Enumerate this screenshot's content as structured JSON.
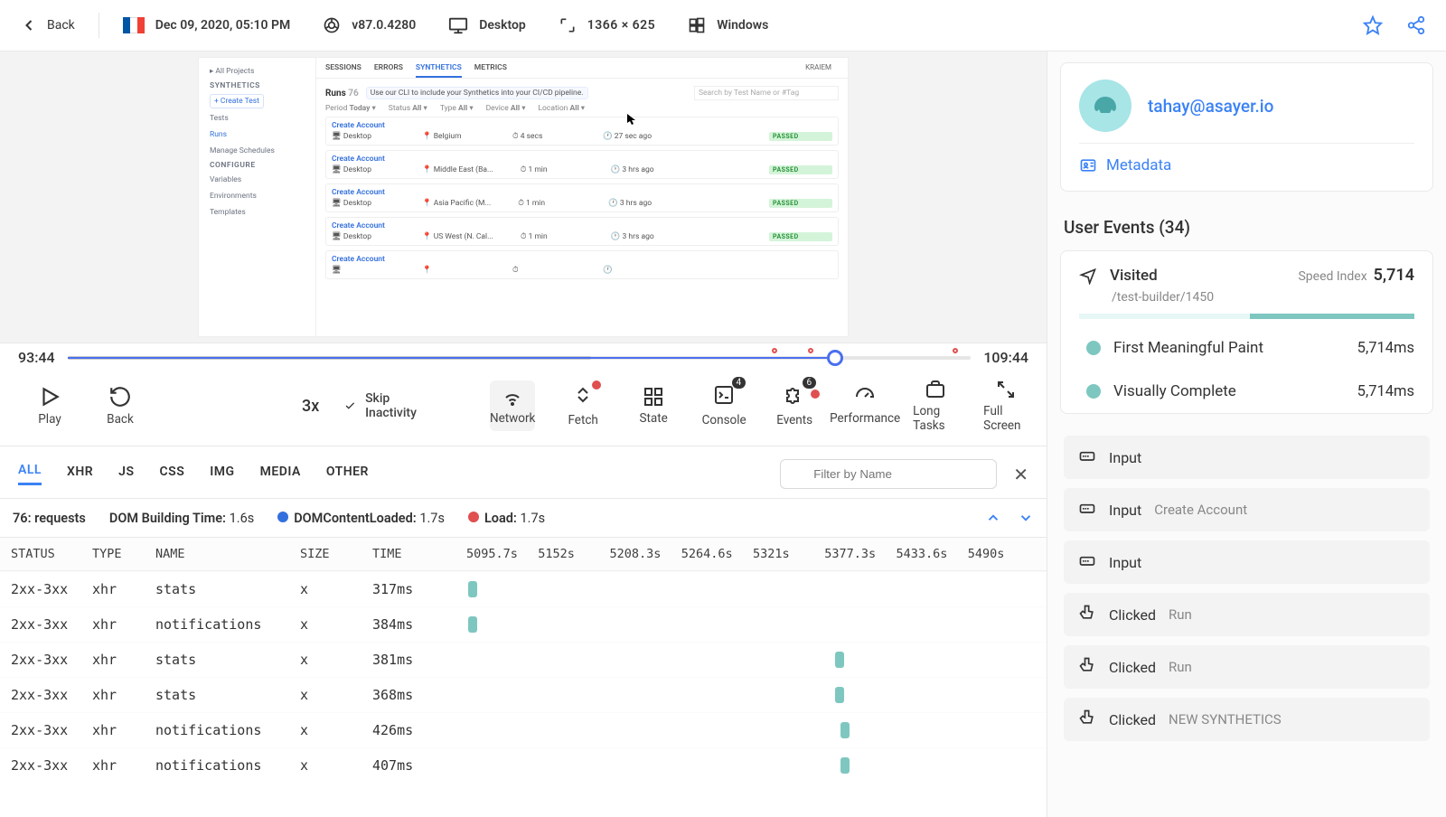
{
  "topbar": {
    "back_label": "Back",
    "date": "Dec 09, 2020, 05:10 PM",
    "browser_version": "v87.0.4280",
    "device": "Desktop",
    "dimensions": "1366 × 625",
    "os": "Windows"
  },
  "preview": {
    "side_header": "SYNTHETICS",
    "create_btn": "+ Create Test",
    "nav_tests": "Tests",
    "nav_runs": "Runs",
    "nav_schedules": "Manage Schedules",
    "config_header": "CONFIGURE",
    "nav_variables": "Variables",
    "nav_env": "Environments",
    "nav_templates": "Templates",
    "all_projects": "All Projects",
    "tabs_sessions": "SESSIONS",
    "tabs_errors": "ERRORS",
    "tabs_synthetics": "SYNTHETICS",
    "tabs_metrics": "METRICS",
    "user": "KRAIEM",
    "runs_label": "Runs",
    "runs_count": "76",
    "hint": "Use our CLI to include your Synthetics into your CI/CD pipeline.",
    "search_placeholder": "Search by Test Name or #Tag",
    "filters": {
      "period": "Period",
      "period_v": "Today",
      "status": "Status",
      "status_v": "All",
      "type": "Type",
      "type_v": "All",
      "device": "Device",
      "device_v": "All",
      "location": "Location",
      "location_v": "All"
    },
    "rows": [
      {
        "name": "Create Account",
        "device": "Desktop",
        "loc": "Belgium",
        "dur": "4 secs",
        "when": "27 sec ago",
        "status": "PASSED"
      },
      {
        "name": "Create Account",
        "device": "Desktop",
        "loc": "Middle East (Ba...",
        "dur": "1 min",
        "when": "3 hrs ago",
        "status": "PASSED"
      },
      {
        "name": "Create Account",
        "device": "Desktop",
        "loc": "Asia Pacific (M...",
        "dur": "1 min",
        "when": "3 hrs ago",
        "status": "PASSED"
      },
      {
        "name": "Create Account",
        "device": "Desktop",
        "loc": "US West (N. Cal...",
        "dur": "1 min",
        "when": "3 hrs ago",
        "status": "PASSED"
      },
      {
        "name": "Create Account",
        "device": "",
        "loc": "",
        "dur": "",
        "when": "",
        "status": ""
      }
    ]
  },
  "timeline": {
    "current": "93:44",
    "total": "109:44"
  },
  "controls": {
    "play": "Play",
    "back": "Back",
    "speed": "3x",
    "skip": "Skip Inactivity",
    "network": "Network",
    "fetch": "Fetch",
    "state": "State",
    "console": "Console",
    "console_badge": "4",
    "events": "Events",
    "events_badge": "6",
    "performance": "Performance",
    "longtasks": "Long Tasks",
    "fullscreen": "Full Screen"
  },
  "netTabs": {
    "all": "ALL",
    "xhr": "XHR",
    "js": "JS",
    "css": "CSS",
    "img": "IMG",
    "media": "MEDIA",
    "other": "OTHER",
    "filter_placeholder": "Filter by Name"
  },
  "stats": {
    "requests_label": "76: requests",
    "dom_build_label": "DOM Building Time:",
    "dom_build_value": "1.6s",
    "dcl_label": "DOMContentLoaded:",
    "dcl_value": "1.7s",
    "load_label": "Load:",
    "load_value": "1.7s"
  },
  "netHeaders": {
    "status": "STATUS",
    "type": "TYPE",
    "name": "NAME",
    "size": "SIZE",
    "time": "TIME"
  },
  "ticks": [
    "5095.7s",
    "5152s",
    "5208.3s",
    "5264.6s",
    "5321s",
    "5377.3s",
    "5433.6s",
    "5490s"
  ],
  "netRows": [
    {
      "status": "2xx-3xx",
      "type": "xhr",
      "name": "stats",
      "size": "x",
      "time": "317ms",
      "pos": 1
    },
    {
      "status": "2xx-3xx",
      "type": "xhr",
      "name": "notifications",
      "size": "x",
      "time": "384ms",
      "pos": 1
    },
    {
      "status": "2xx-3xx",
      "type": "xhr",
      "name": "stats",
      "size": "x",
      "time": "381ms",
      "pos": 65
    },
    {
      "status": "2xx-3xx",
      "type": "xhr",
      "name": "stats",
      "size": "x",
      "time": "368ms",
      "pos": 65
    },
    {
      "status": "2xx-3xx",
      "type": "xhr",
      "name": "notifications",
      "size": "x",
      "time": "426ms",
      "pos": 66
    },
    {
      "status": "2xx-3xx",
      "type": "xhr",
      "name": "notifications",
      "size": "x",
      "time": "407ms",
      "pos": 66
    }
  ],
  "rsb": {
    "email": "tahay@asayer.io",
    "metadata_label": "Metadata",
    "events_title": "User Events (34)",
    "visited_label": "Visited",
    "visited_path": "/test-builder/1450",
    "speed_index_label": "Speed Index",
    "speed_index_value": "5,714",
    "fmp_label": "First Meaningful Paint",
    "fmp_value": "5,714ms",
    "vc_label": "Visually Complete",
    "vc_value": "5,714ms",
    "events": [
      {
        "type": "Input",
        "sub": ""
      },
      {
        "type": "Input",
        "sub": "Create Account"
      },
      {
        "type": "Input",
        "sub": ""
      },
      {
        "type": "Clicked",
        "sub": "Run"
      },
      {
        "type": "Clicked",
        "sub": "Run"
      },
      {
        "type": "Clicked",
        "sub": "NEW SYNTHETICS"
      }
    ]
  }
}
